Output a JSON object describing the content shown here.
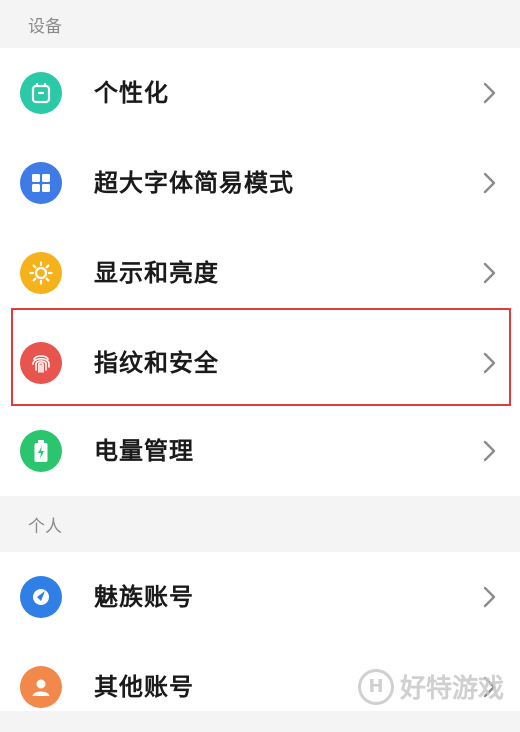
{
  "sections": {
    "device": "设备",
    "personal": "个人"
  },
  "items": [
    {
      "label": "个性化",
      "icon": "personalize-icon",
      "color": "#2cc9a8"
    },
    {
      "label": "超大字体简易模式",
      "icon": "grid-icon",
      "color": "#3f7be6"
    },
    {
      "label": "显示和亮度",
      "icon": "sun-icon",
      "color": "#f6b21a"
    },
    {
      "label": "指纹和安全",
      "icon": "fingerprint-icon",
      "color": "#e8554e"
    },
    {
      "label": "电量管理",
      "icon": "battery-icon",
      "color": "#2bc56e"
    },
    {
      "label": "魅族账号",
      "icon": "meizu-account-icon",
      "color": "#2f7fe6"
    },
    {
      "label": "其他账号",
      "icon": "user-icon",
      "color": "#f2894a"
    }
  ],
  "highlight_color": "#e23b3b",
  "watermark": "好特游戏",
  "watermark_logo": "H"
}
